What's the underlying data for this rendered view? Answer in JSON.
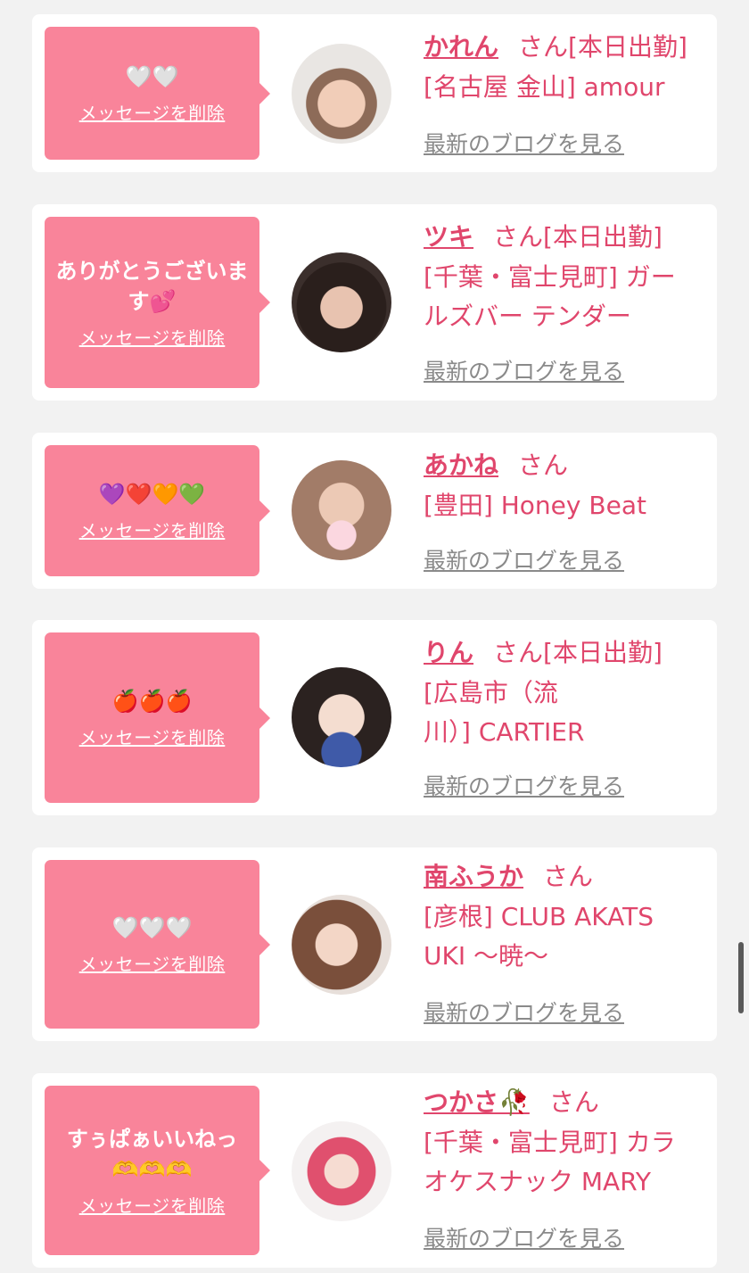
{
  "cards": [
    {
      "message": "🤍🤍",
      "delete_label": "メッセージを削除",
      "name": "かれん",
      "suffix": "さん[本日出勤]",
      "shop": "[名古屋 金山] amour",
      "blog_label": "最新のブログを見る"
    },
    {
      "message": "ありがとうございます💕",
      "delete_label": "メッセージを削除",
      "name": "ツキ",
      "suffix": "さん[本日出勤]",
      "shop": "[千葉・富士見町] ガールズバー テンダー",
      "blog_label": "最新のブログを見る"
    },
    {
      "message": "💜❤️🧡💚",
      "delete_label": "メッセージを削除",
      "name": "あかね",
      "suffix": "さん",
      "shop": "[豊田] Honey Beat",
      "blog_label": "最新のブログを見る"
    },
    {
      "message": "🍎🍎🍎",
      "delete_label": "メッセージを削除",
      "name": "りん",
      "suffix": "さん[本日出勤]",
      "shop": "[広島市（流川）] CARTIER",
      "blog_label": "最新のブログを見る"
    },
    {
      "message": "🤍🤍🤍",
      "delete_label": "メッセージを削除",
      "name": "南ふうか",
      "suffix": "さん",
      "shop": "[彦根] CLUB AKATSUKI 〜暁〜",
      "blog_label": "最新のブログを見る"
    },
    {
      "message": "すぅぱぁいいねっ🫶🫶🫶",
      "delete_label": "メッセージを削除",
      "name": "つかさ🥀",
      "suffix": "さん",
      "shop": "[千葉・富士見町] カラオケスナック MARY",
      "blog_label": "最新のブログを見る"
    }
  ],
  "colors": {
    "bubble": "#f9849a",
    "accent_text": "#e0466c",
    "link_gray": "#8a8a8a",
    "background": "#f2f2f2"
  }
}
